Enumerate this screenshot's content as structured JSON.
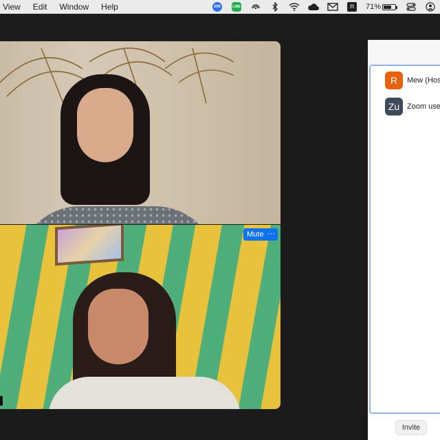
{
  "menubar": {
    "items": [
      "View",
      "Edit",
      "Window",
      "Help"
    ],
    "status": {
      "zoom_badge": "zm",
      "line_badge": "LINE",
      "n_badge": "n",
      "battery_percent_text": "71%",
      "battery_level": 0.71,
      "icons": [
        "zoom-icon",
        "line-icon",
        "airdrop-icon",
        "bluetooth-icon",
        "wifi-icon",
        "cloud-icon",
        "mail-icon",
        "notion-icon",
        "battery-icon",
        "control-center-icon",
        "user-icon"
      ]
    }
  },
  "video": {
    "mute_label": "Mute",
    "more_label": "···"
  },
  "participants": {
    "items": [
      {
        "initials": "R",
        "name": "Mew (Host",
        "avatar_color": "#e8620e"
      },
      {
        "initials": "Zu",
        "name": "Zoom user",
        "avatar_color": "#3d4a5a"
      }
    ],
    "invite_label": "Invite"
  }
}
